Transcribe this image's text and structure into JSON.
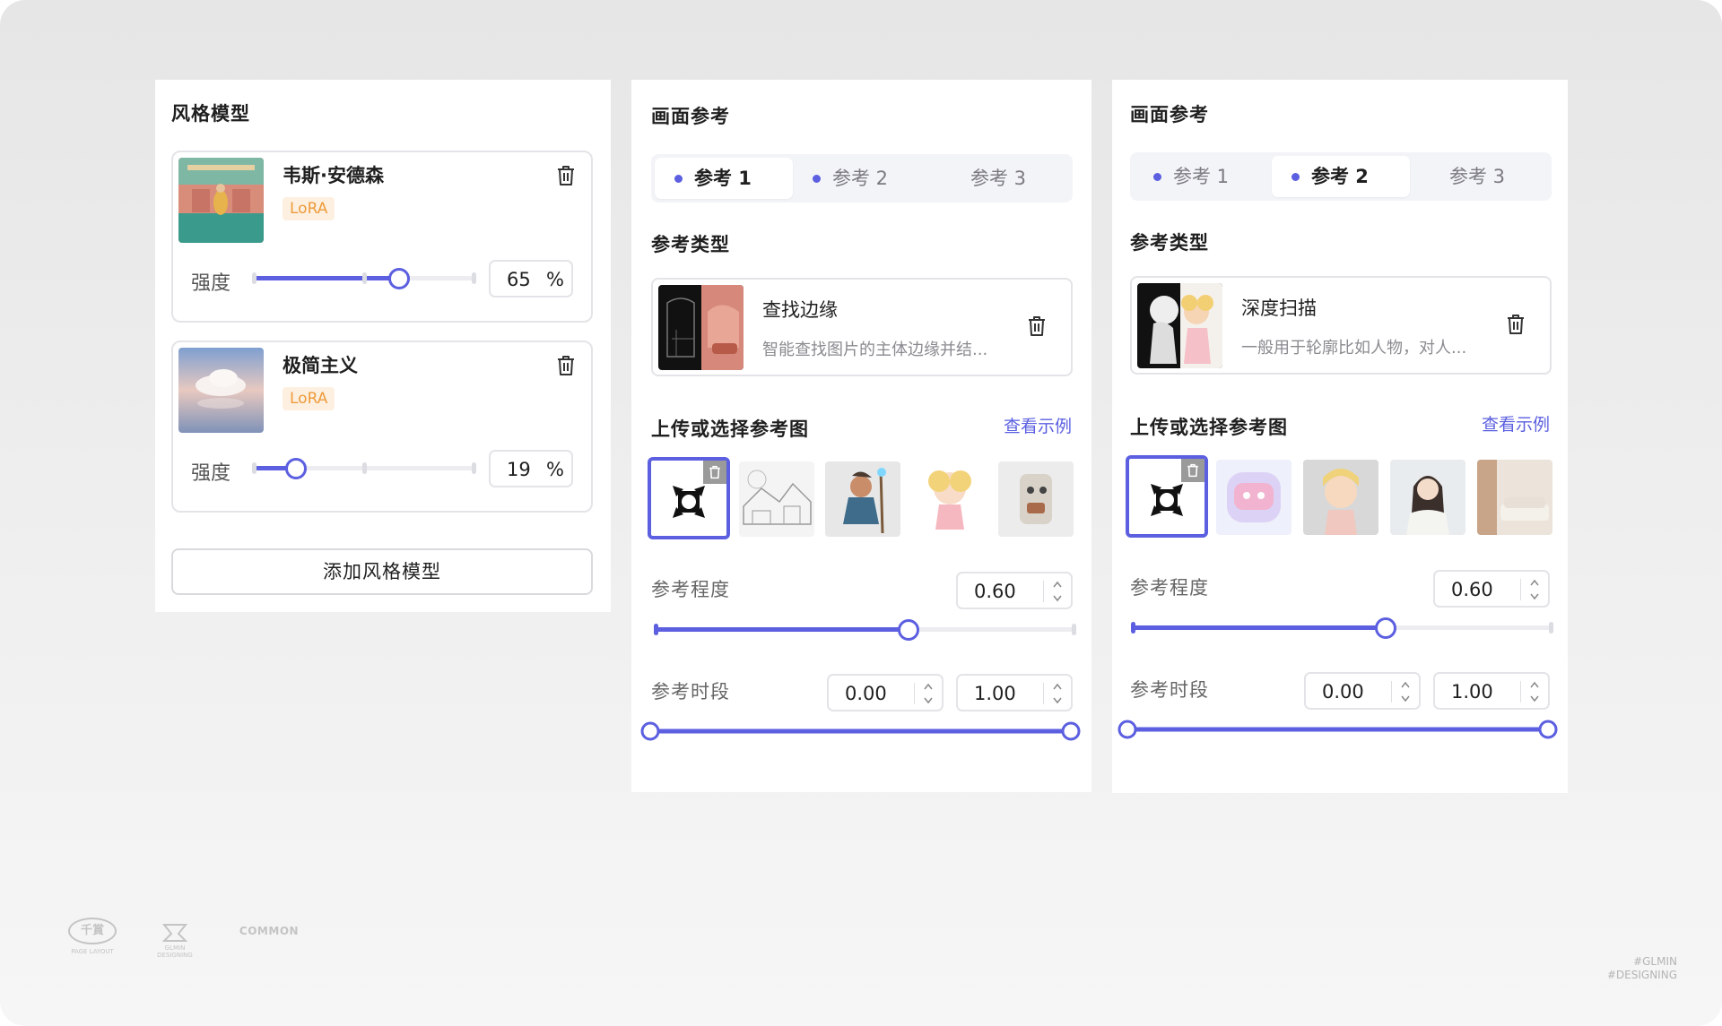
{
  "style_panel": {
    "title": "风格模型",
    "models": [
      {
        "name": "韦斯·安德森",
        "badge": "LoRA",
        "strength_label": "强度",
        "strength": 65,
        "unit": "%"
      },
      {
        "name": "极简主义",
        "badge": "LoRA",
        "strength_label": "强度",
        "strength": 19,
        "unit": "%"
      }
    ],
    "add_button": "添加风格模型"
  },
  "ref_panels": [
    {
      "title": "画面参考",
      "tabs": [
        "参考 1",
        "参考 2",
        "参考 3"
      ],
      "active_tab": 0,
      "type_section": "参考类型",
      "type_name": "查找边缘",
      "type_desc": "智能查找图片的主体边缘并结...",
      "upload_section": "上传或选择参考图",
      "example_link": "查看示例",
      "degree_label": "参考程度",
      "degree_value": "0.60",
      "degree": 0.6,
      "period_label": "参考时段",
      "period_start": "0.00",
      "period_end": "1.00"
    },
    {
      "title": "画面参考",
      "tabs": [
        "参考 1",
        "参考 2",
        "参考 3"
      ],
      "active_tab": 1,
      "type_section": "参考类型",
      "type_name": "深度扫描",
      "type_desc": "一般用于轮廓比如人物，对人...",
      "upload_section": "上传或选择参考图",
      "example_link": "查看示例",
      "degree_label": "参考程度",
      "degree_value": "0.60",
      "degree": 0.6,
      "period_label": "参考时段",
      "period_start": "0.00",
      "period_end": "1.00"
    }
  ],
  "footer": {
    "logo_1": "千賞",
    "logo_1_caption": "PAGE LAYOUT",
    "logo_2_caption": "GLMIN DESIGNING",
    "logo_3": "COMMON",
    "tag_line_1": "#GLMIN",
    "tag_line_2": "#DESIGNING"
  },
  "colors": {
    "accent": "#5b5fe0",
    "badge_text": "#ee9b3a",
    "badge_bg": "#fdf0e1"
  },
  "icons": [
    "trash-icon",
    "crosshair-icon",
    "stepper-arrows-icon"
  ]
}
